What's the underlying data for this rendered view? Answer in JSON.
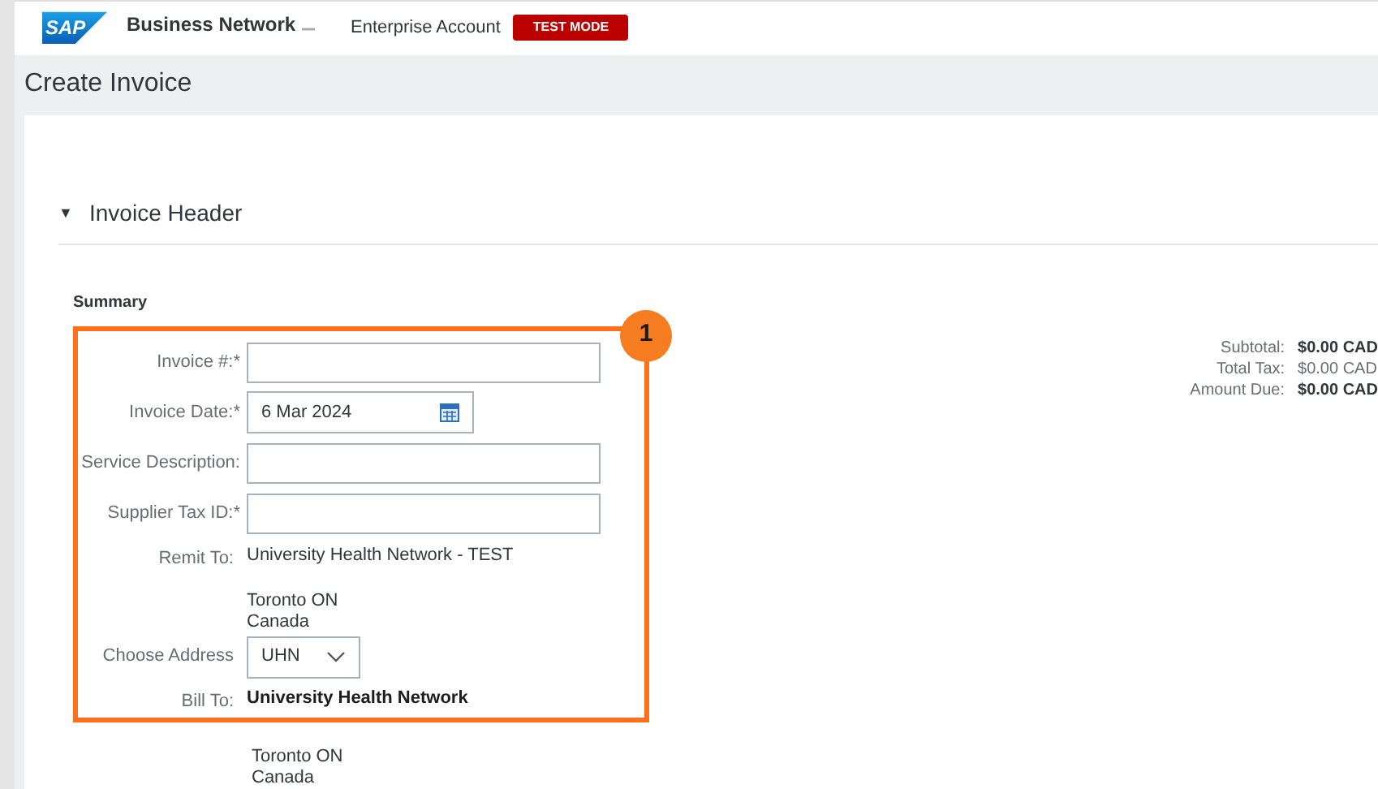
{
  "header": {
    "logo": "SAP",
    "product": "Business Network",
    "account": "Enterprise Account",
    "mode_badge": "TEST MODE"
  },
  "page_title": "Create Invoice",
  "section": {
    "title": "Invoice Header",
    "toggle": "▼"
  },
  "summary_heading": "Summary",
  "callout": "1",
  "fields": [
    {
      "kind": "input",
      "label": "Invoice #:*"
    },
    {
      "kind": "date",
      "label": "Invoice Date:*",
      "value": "6 Mar 2024"
    },
    {
      "kind": "input",
      "label": "Service Description:"
    },
    {
      "kind": "input",
      "label": "Supplier Tax ID:*"
    },
    {
      "kind": "address",
      "label": "Remit To:",
      "name": "University Health Network - TEST",
      "lines": [
        "Toronto ON",
        "Canada"
      ],
      "bold": false
    },
    {
      "kind": "select",
      "label": "Choose Address",
      "value": "UHN"
    },
    {
      "kind": "address",
      "label": "Bill To:",
      "name": "University Health Network",
      "lines": [
        "Toronto ON",
        "Canada"
      ],
      "bold": true
    }
  ],
  "totals": [
    {
      "label": "Subtotal:",
      "value": "$0.00 CAD",
      "bold": true
    },
    {
      "label": "Total Tax:",
      "value": "$0.00 CAD",
      "bold": false
    },
    {
      "label": "Amount Due:",
      "value": "$0.00 CAD",
      "bold": true
    }
  ]
}
